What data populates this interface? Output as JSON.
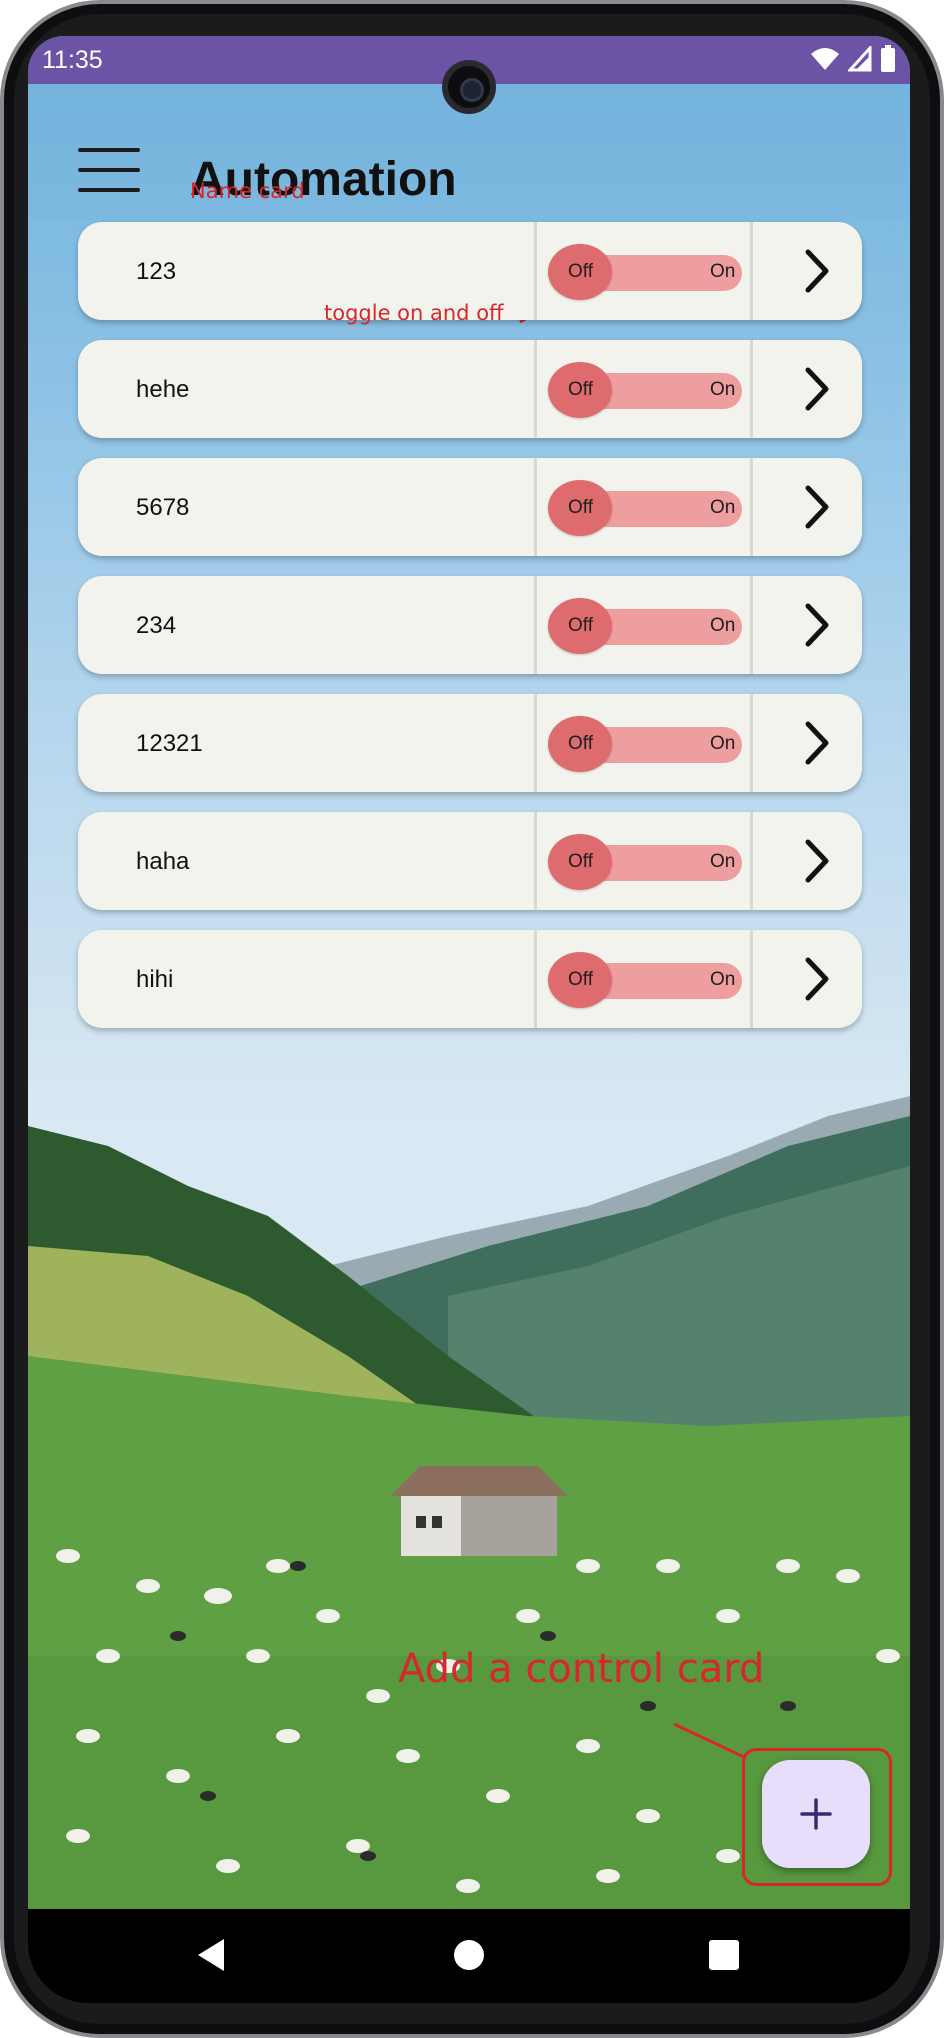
{
  "status_bar": {
    "time": "11:35"
  },
  "app_bar": {
    "title": "Automation"
  },
  "annotations": {
    "name_card": "Name card",
    "toggle": "toggle on and off",
    "add_card": "Add a control card"
  },
  "cards": [
    {
      "name": "123",
      "off_label": "Off",
      "on_label": "On",
      "state": "off"
    },
    {
      "name": "hehe",
      "off_label": "Off",
      "on_label": "On",
      "state": "off"
    },
    {
      "name": "5678",
      "off_label": "Off",
      "on_label": "On",
      "state": "off"
    },
    {
      "name": "234",
      "off_label": "Off",
      "on_label": "On",
      "state": "off"
    },
    {
      "name": "12321",
      "off_label": "Off",
      "on_label": "On",
      "state": "off"
    },
    {
      "name": "haha",
      "off_label": "Off",
      "on_label": "On",
      "state": "off"
    },
    {
      "name": "hihi",
      "off_label": "Off",
      "on_label": "On",
      "state": "off"
    }
  ],
  "fab": {
    "icon": "plus-icon"
  },
  "colors": {
    "status_bar": "#6b53a6",
    "card_bg": "#f3f3ee",
    "toggle_track": "#ef9ea0",
    "toggle_knob": "#de6c6f",
    "fab_bg": "#e8defb",
    "annotation": "#d8262c"
  }
}
